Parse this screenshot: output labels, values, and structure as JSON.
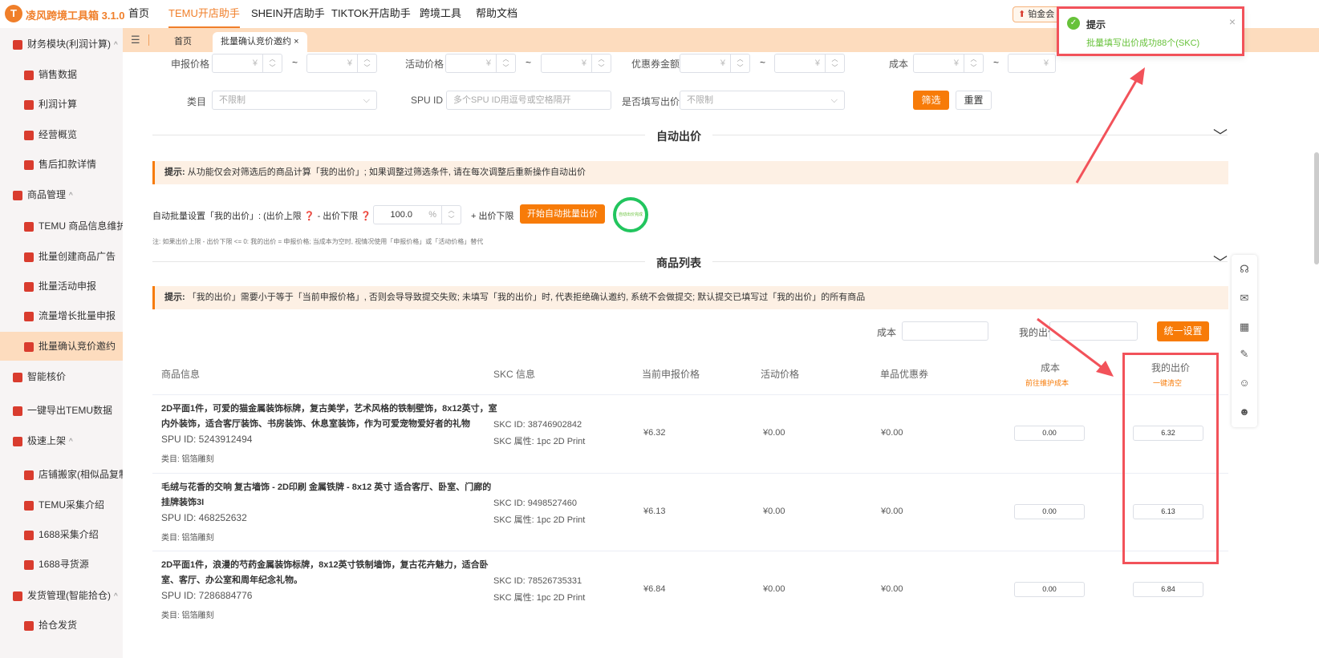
{
  "header": {
    "logo_letter": "T",
    "app_name": "凌风跨境工具箱 3.1.0",
    "nav": [
      "首页",
      "TEMU开店助手",
      "SHEIN开店助手",
      "TIKTOK开店助手",
      "跨境工具",
      "帮助文档"
    ],
    "active_nav": "TEMU开店助手",
    "vip_label": "铂金会"
  },
  "tabs": {
    "items": [
      "首页",
      "批量确认竞价邀约"
    ],
    "close": "×"
  },
  "sidebar": {
    "items": [
      {
        "label": "财务模块(利润计算)",
        "type": "group"
      },
      {
        "label": "销售数据",
        "type": "sub"
      },
      {
        "label": "利润计算",
        "type": "sub"
      },
      {
        "label": "经营概览",
        "type": "sub"
      },
      {
        "label": "售后扣款详情",
        "type": "sub"
      },
      {
        "label": "商品管理",
        "type": "group"
      },
      {
        "label": "TEMU 商品信息维护",
        "type": "sub"
      },
      {
        "label": "批量创建商品广告",
        "type": "sub"
      },
      {
        "label": "批量活动申报",
        "type": "sub"
      },
      {
        "label": "流量增长批量申报",
        "type": "sub"
      },
      {
        "label": "批量确认竞价邀约",
        "type": "sub",
        "active": true
      },
      {
        "label": "智能核价",
        "type": "group"
      },
      {
        "label": "一键导出TEMU数据",
        "type": "group"
      },
      {
        "label": "极速上架",
        "type": "group"
      },
      {
        "label": "店铺搬家(相似品复制上",
        "type": "sub"
      },
      {
        "label": "TEMU采集介绍",
        "type": "sub"
      },
      {
        "label": "1688采集介绍",
        "type": "sub"
      },
      {
        "label": "1688寻货源",
        "type": "sub"
      },
      {
        "label": "发货管理(智能拾仓)",
        "type": "group"
      },
      {
        "label": "拾仓发货",
        "type": "sub"
      }
    ]
  },
  "filters": {
    "declared_price": "申报价格",
    "activity_price": "活动价格",
    "coupon_amount": "优惠券金额",
    "cost": "成本",
    "yen": "¥",
    "tilde": "~",
    "category": "类目",
    "category_value": "不限制",
    "spu_id": "SPU ID",
    "spu_placeholder": "多个SPU ID用逗号或空格隔开",
    "filled_bid": "是否填写出价",
    "filled_value": "不限制",
    "filter_btn": "筛选",
    "reset_btn": "重置"
  },
  "auto": {
    "title": "自动出价",
    "tip_bold": "提示:",
    "tip": "从功能仅会对筛选后的商品计算「我的出价」; 如果调整过筛选条件, 请在每次调整后重新操作自动出价",
    "setting_label": "自动批量设置「我的出价」: (出价上限 ❓ - 出价下限 ❓ ) *",
    "percent_value": "100.0",
    "percent_unit": "%",
    "plus_lower": "+ 出价下限",
    "start_btn": "开始自动批量出价",
    "done_label": "自动出价完成",
    "note": "注: 如果出价上限 - 出价下限 <= 0: 我的出价 = 申报价格; 当成本为空时, 视情况使用「申报价格」或「活动价格」替代"
  },
  "list": {
    "title": "商品列表",
    "tip_bold": "提示:",
    "tip": "「我的出价」需要小于等于「当前申报价格」, 否则会导导致提交失败; 未填写「我的出价」时, 代表拒绝确认邀约, 系统不会做提交; 默认提交已填写过「我的出价」的所有商品",
    "cost_label": "成本",
    "bid_label": "我的出价",
    "set_all_btn": "统一设置",
    "columns": [
      "商品信息",
      "SKC 信息",
      "当前申报价格",
      "活动价格",
      "单品优惠券",
      "成本",
      "我的出价"
    ],
    "cost_link": "前往维护成本",
    "clear_link": "一键清空",
    "rows": [
      {
        "name": "2D平面1件，可爱的猫金属装饰标牌，复古美学，艺术风格的铁制壁饰，8x12英寸，室内外装饰，适合客厅装饰、书房装饰、休息室装饰，作为可爱宠物爱好者的礼物",
        "spu": "SPU ID: 5243912494",
        "category": "类目: 铝箔雕刻",
        "skc_id": "SKC ID: 38746902842",
        "skc_attr": "SKC 属性: 1pc 2D Print",
        "declared": "¥6.32",
        "activity": "¥0.00",
        "coupon": "¥0.00",
        "cost": "0.00",
        "bid": "6.32"
      },
      {
        "name": "毛绒与花香的交响 复古墙饰 - 2D印刷 金属铁牌 - 8x12 英寸 适合客厅、卧室、门廊的挂牌装饰3I",
        "spu": "SPU ID: 468252632",
        "category": "类目: 铝箔雕刻",
        "skc_id": "SKC ID: 9498527460",
        "skc_attr": "SKC 属性: 1pc 2D Print",
        "declared": "¥6.13",
        "activity": "¥0.00",
        "coupon": "¥0.00",
        "cost": "0.00",
        "bid": "6.13"
      },
      {
        "name": "2D平面1件，浪漫的芍药金属装饰标牌，8x12英寸铁制墙饰，复古花卉魅力，适合卧室、客厅、办公室和周年纪念礼物。",
        "spu": "SPU ID: 7286884776",
        "category": "类目: 铝箔雕刻",
        "skc_id": "SKC ID: 78526735331",
        "skc_attr": "SKC 属性: 1pc 2D Print",
        "declared": "¥6.84",
        "activity": "¥0.00",
        "coupon": "¥0.00",
        "cost": "0.00",
        "bid": "6.84"
      }
    ]
  },
  "toast": {
    "title": "提示",
    "message": "批量填写出价成功88个(SKC)",
    "close": "×"
  },
  "colors": {
    "accent": "#f77b08",
    "highlight": "#f2525a",
    "success": "#67c23a"
  }
}
